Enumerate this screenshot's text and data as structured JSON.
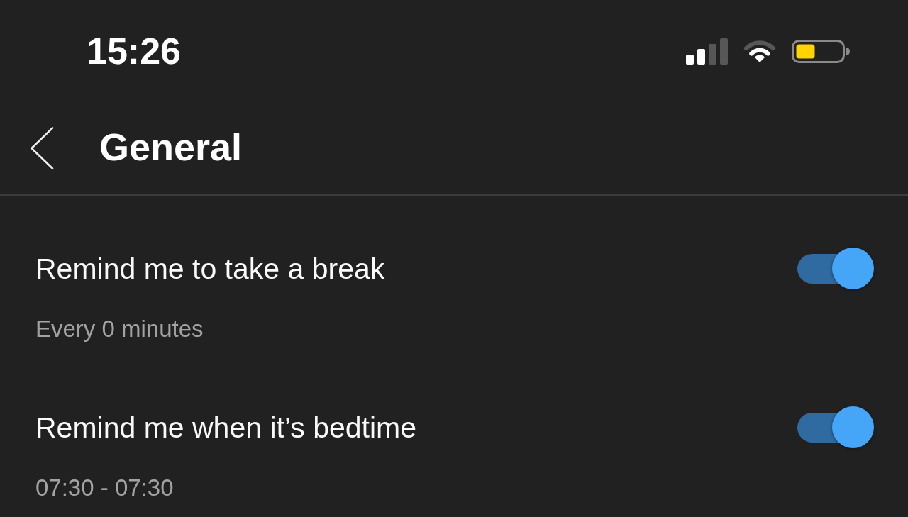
{
  "status_bar": {
    "time": "15:26"
  },
  "header": {
    "title": "General"
  },
  "settings": [
    {
      "label": "Remind me to take a break",
      "detail": "Every 0 minutes",
      "on": true
    },
    {
      "label": "Remind me when it’s bedtime",
      "detail": "07:30 - 07:30",
      "on": true
    }
  ]
}
